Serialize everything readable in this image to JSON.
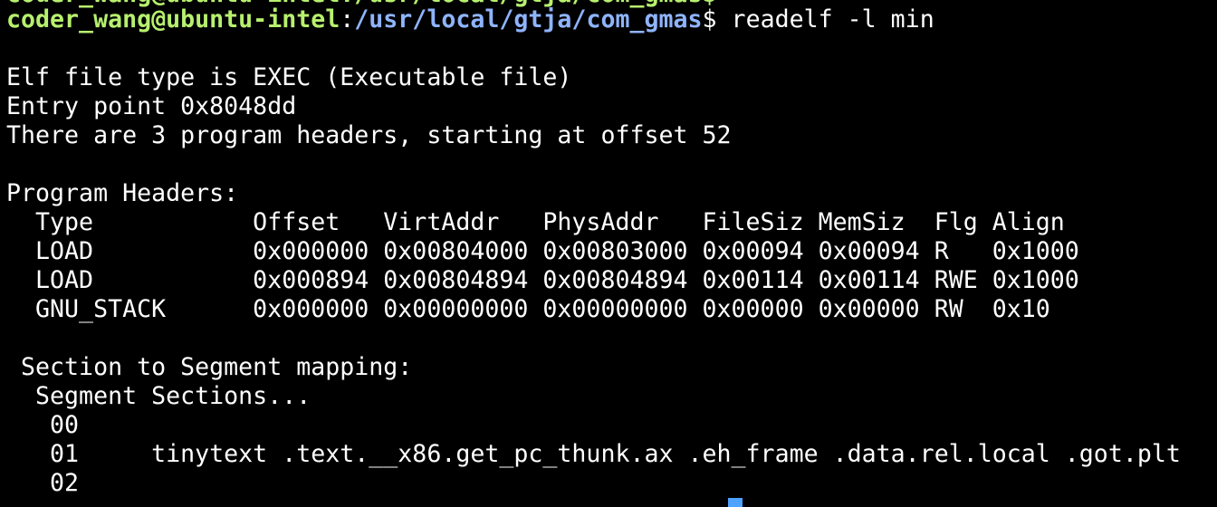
{
  "prompt": {
    "top_clipped_prefix": "coder_wang@ubuntu-intel:/usr/local/gtja/com_gmas$",
    "user_host": "coder_wang@ubuntu-intel",
    "colon": ":",
    "path": "/usr/local/gtja/com_gmas",
    "dollar": "$",
    "command": " readelf -l min"
  },
  "output": {
    "file_type": "Elf file type is EXEC (Executable file)",
    "entry_point": "Entry point 0x8048dd",
    "headers_info": "There are 3 program headers, starting at offset 52",
    "program_headers_title": "Program Headers:",
    "table_header": "  Type           Offset   VirtAddr   PhysAddr   FileSiz MemSiz  Flg Align",
    "rows": [
      "  LOAD           0x000000 0x00804000 0x00803000 0x00094 0x00094 R   0x1000",
      "  LOAD           0x000894 0x00804894 0x00804894 0x00114 0x00114 RWE 0x1000",
      "  GNU_STACK      0x000000 0x00000000 0x00000000 0x00000 0x00000 RW  0x10"
    ],
    "mapping_title": " Section to Segment mapping:",
    "mapping_header": "  Segment Sections...",
    "segments": [
      "   00",
      "   01     tinytext .text.__x86.get_pc_thunk.ax .eh_frame .data.rel.local .got.plt",
      "   02"
    ]
  },
  "colors": {
    "background": "#000000",
    "text": "#ffffff",
    "user_host": "#b7f06e",
    "path": "#8fb4ff",
    "cursor": "#4da3ff"
  }
}
